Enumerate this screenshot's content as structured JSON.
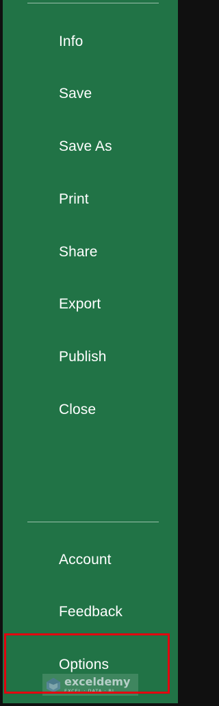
{
  "menu": {
    "items": [
      {
        "label": "Info"
      },
      {
        "label": "Save"
      },
      {
        "label": "Save As"
      },
      {
        "label": "Print"
      },
      {
        "label": "Share"
      },
      {
        "label": "Export"
      },
      {
        "label": "Publish"
      },
      {
        "label": "Close"
      }
    ],
    "bottom_items": [
      {
        "label": "Account"
      },
      {
        "label": "Feedback"
      },
      {
        "label": "Options"
      }
    ],
    "highlighted_item": "Options"
  },
  "watermark": {
    "name": "exceldemy",
    "tagline": "EXCEL · DATA · BI"
  },
  "colors": {
    "backstage_background": "#217346",
    "text": "#ffffff",
    "highlight_border": "#e3000f",
    "frame": "#101010"
  }
}
